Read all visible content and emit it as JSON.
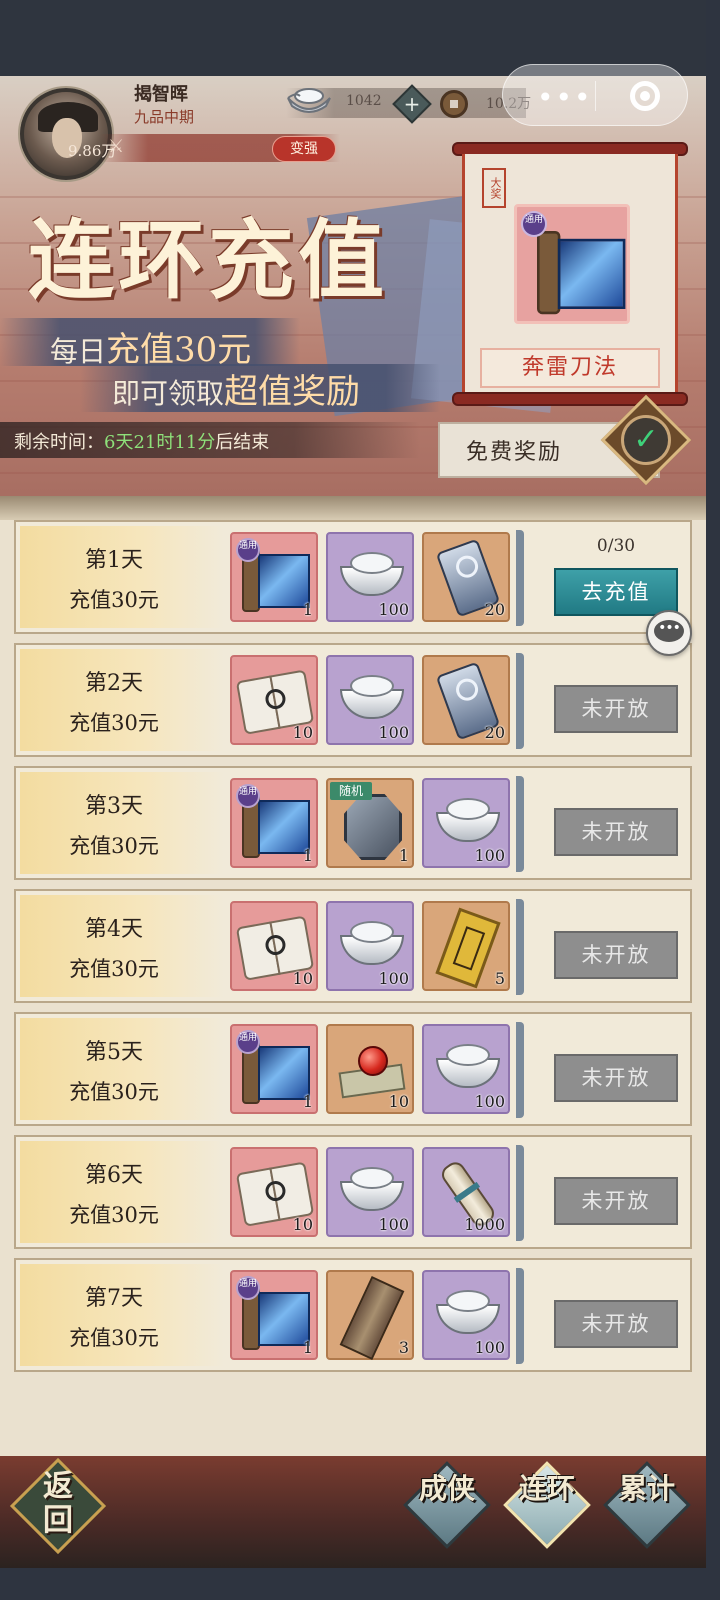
{
  "player": {
    "name": "揭智晖",
    "rank": "九品中期",
    "power": "9.86万",
    "stronger_label": "变强"
  },
  "currency": {
    "ingot": "1042",
    "coin": "10.2万"
  },
  "banner": {
    "title": "连环充值",
    "line1_prefix": "每日",
    "line1_highlight": "充值30元",
    "line2_prefix": "即可领取",
    "line2_highlight": "超值奖励",
    "timer_prefix": "剩余时间：",
    "timer_value": "6天21时11分",
    "timer_suffix": "后结束",
    "featured_seal": "大奖",
    "featured_badge": "通用",
    "featured_name": "奔雷刀法",
    "free_reward_label": "免费奖励"
  },
  "days": [
    {
      "day": "第1天",
      "req": "充值30元",
      "progress": "0/30",
      "action": "去充值",
      "status": "active",
      "items": [
        {
          "art": "skill-scroll",
          "tier": "red",
          "badge": "通用",
          "count": "1"
        },
        {
          "art": "silver-ingot",
          "tier": "purple",
          "count": "100"
        },
        {
          "art": "jade-token",
          "tier": "orange",
          "count": "20"
        }
      ]
    },
    {
      "day": "第2天",
      "req": "充值30元",
      "action": "未开放",
      "status": "locked",
      "items": [
        {
          "art": "manual-book",
          "tier": "red",
          "count": "10"
        },
        {
          "art": "silver-ingot",
          "tier": "purple",
          "count": "100"
        },
        {
          "art": "jade-token",
          "tier": "orange",
          "count": "20"
        }
      ]
    },
    {
      "day": "第3天",
      "req": "充值30元",
      "action": "未开放",
      "status": "locked",
      "items": [
        {
          "art": "skill-scroll",
          "tier": "red",
          "badge": "通用",
          "count": "1"
        },
        {
          "art": "random-stone",
          "tier": "orange",
          "tag": "随机",
          "count": "1"
        },
        {
          "art": "silver-ingot",
          "tier": "purple",
          "count": "100"
        }
      ]
    },
    {
      "day": "第4天",
      "req": "充值30元",
      "action": "未开放",
      "status": "locked",
      "items": [
        {
          "art": "manual-book",
          "tier": "red",
          "count": "10"
        },
        {
          "art": "silver-ingot",
          "tier": "purple",
          "count": "100"
        },
        {
          "art": "gold-talisman",
          "tier": "orange",
          "count": "5"
        }
      ]
    },
    {
      "day": "第5天",
      "req": "充值30元",
      "action": "未开放",
      "status": "locked",
      "items": [
        {
          "art": "skill-scroll",
          "tier": "red",
          "badge": "通用",
          "count": "1"
        },
        {
          "art": "red-orb",
          "tier": "orange",
          "count": "10"
        },
        {
          "art": "silver-ingot",
          "tier": "purple",
          "count": "100"
        }
      ]
    },
    {
      "day": "第6天",
      "req": "充值30元",
      "action": "未开放",
      "status": "locked",
      "items": [
        {
          "art": "manual-book",
          "tier": "red",
          "count": "10"
        },
        {
          "art": "silver-ingot",
          "tier": "purple",
          "count": "100"
        },
        {
          "art": "paper-roll",
          "tier": "purple",
          "count": "1000"
        }
      ]
    },
    {
      "day": "第7天",
      "req": "充值30元",
      "action": "未开放",
      "status": "locked",
      "items": [
        {
          "art": "skill-scroll",
          "tier": "red",
          "badge": "通用",
          "count": "1"
        },
        {
          "art": "bronze-strip",
          "tier": "orange",
          "count": "3"
        },
        {
          "art": "silver-ingot",
          "tier": "purple",
          "count": "100"
        }
      ]
    }
  ],
  "nav": {
    "back_label": "返回",
    "tabs": [
      "成侠",
      "连环",
      "累计"
    ],
    "active_tab": "连环"
  },
  "colors": {
    "go_button": "#217a84",
    "locked_button": "#8e8e8e",
    "timer_value": "#8ee07a",
    "featured_name": "#c0392b"
  },
  "icons": {
    "power": "crossed-swords-icon",
    "plus": "plus-icon",
    "ingot": "silver-ingot-icon",
    "coin": "copper-coin-icon",
    "menu": "more-dots-icon",
    "close": "target-icon",
    "free_check": "check-icon",
    "chat": "chat-bubble-icon"
  }
}
